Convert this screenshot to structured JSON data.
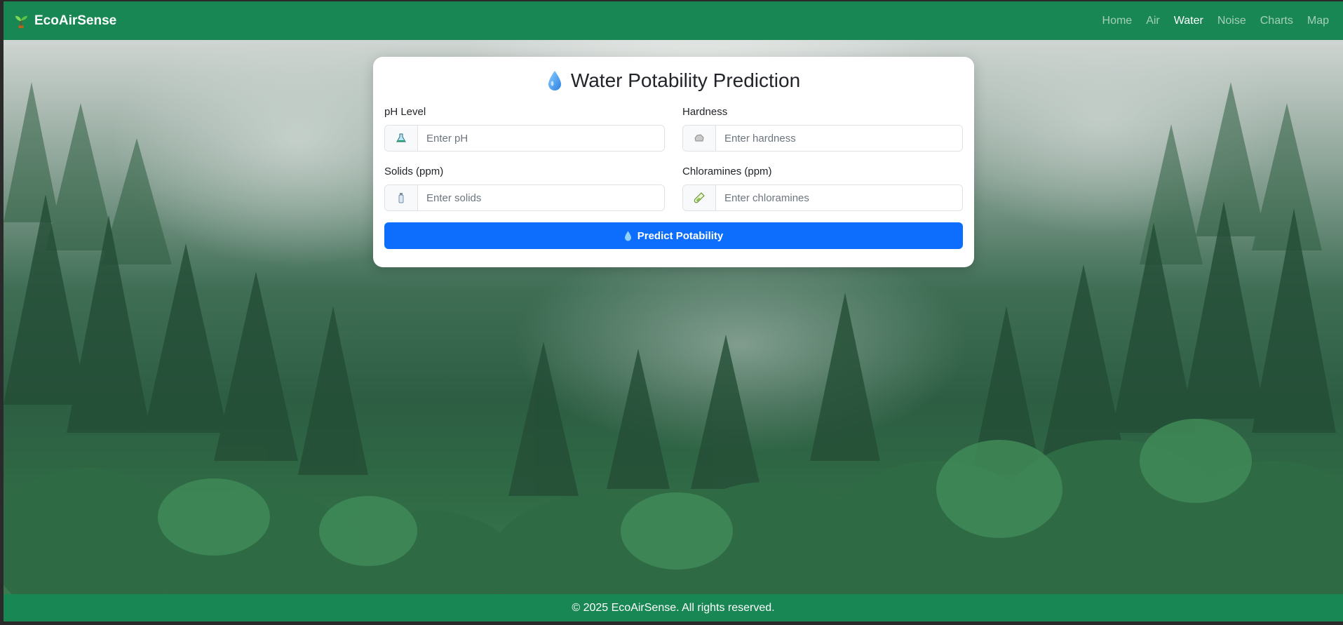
{
  "brand": {
    "name": "EcoAirSense",
    "icon": "seedling-icon"
  },
  "nav": {
    "items": [
      {
        "label": "Home",
        "active": false
      },
      {
        "label": "Air",
        "active": false
      },
      {
        "label": "Water",
        "active": true
      },
      {
        "label": "Noise",
        "active": false
      },
      {
        "label": "Charts",
        "active": false
      },
      {
        "label": "Map",
        "active": false
      }
    ]
  },
  "form": {
    "title": "Water Potability Prediction",
    "title_icon": "droplet-icon",
    "fields": [
      {
        "label": "pH Level",
        "placeholder": "Enter pH",
        "value": "",
        "icon": "flask-icon"
      },
      {
        "label": "Hardness",
        "placeholder": "Enter hardness",
        "value": "",
        "icon": "rock-icon"
      },
      {
        "label": "Solids (ppm)",
        "placeholder": "Enter solids",
        "value": "",
        "icon": "bottle-icon"
      },
      {
        "label": "Chloramines (ppm)",
        "placeholder": "Enter chloramines",
        "value": "",
        "icon": "test-tube-icon"
      }
    ],
    "submit_label": "Predict Potability",
    "submit_icon": "droplet-icon"
  },
  "footer": {
    "text": "© 2025 EcoAirSense. All rights reserved."
  },
  "colors": {
    "navbar": "#198754",
    "primary": "#0d6efd",
    "card": "#ffffff"
  }
}
